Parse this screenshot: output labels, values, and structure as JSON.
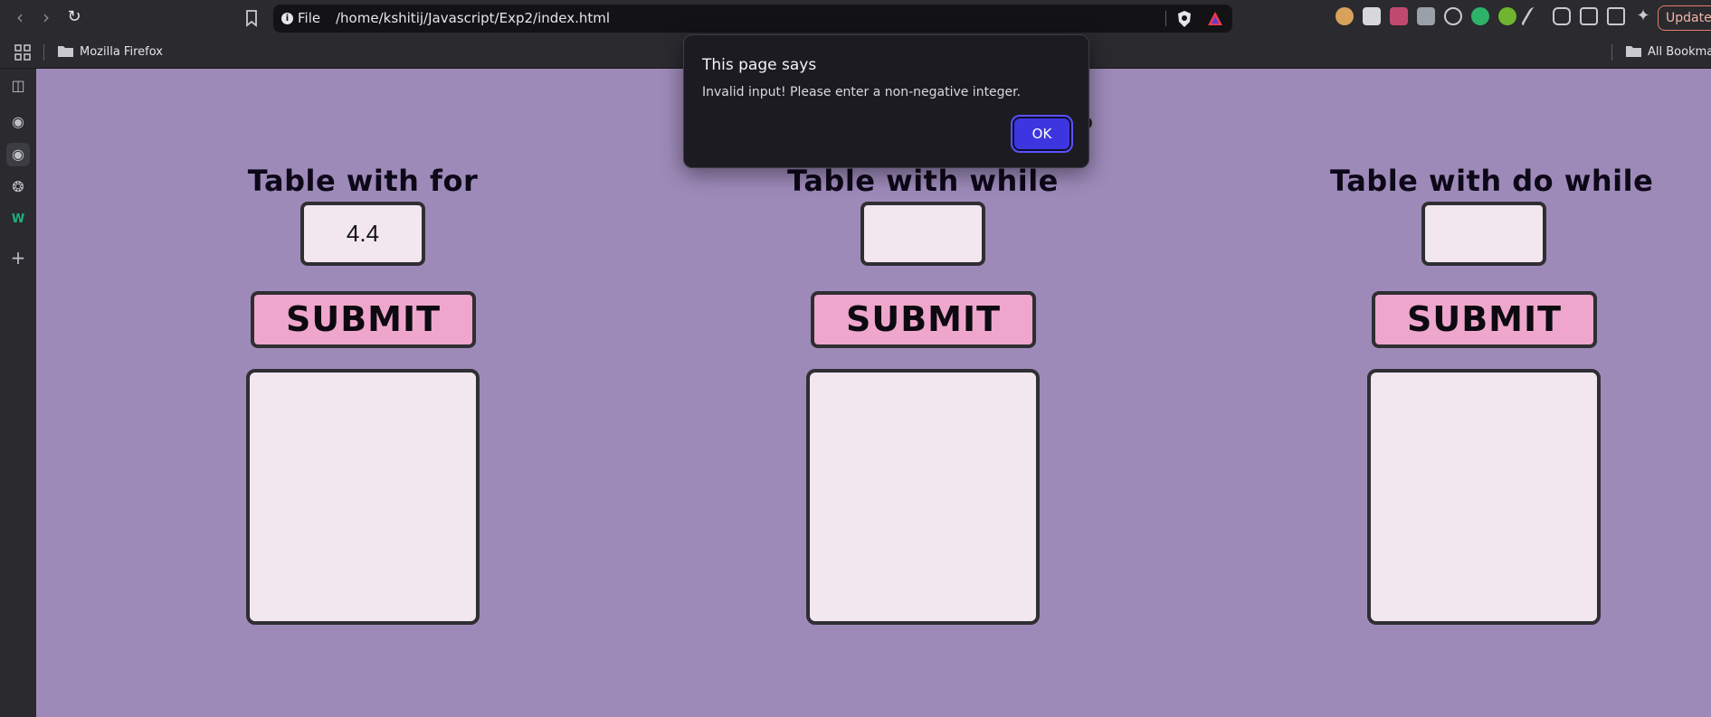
{
  "browser": {
    "url_scheme": "File",
    "url": "/home/kshitij/Javascript/Exp2/index.html",
    "update_label": "Update",
    "bookmarks": [
      {
        "label": "Mozilla Firefox"
      },
      {
        "label": "All Bookmarks"
      }
    ],
    "extensions": [
      "fox-icon",
      "check-icon",
      "brush-icon",
      "bookmark-k-icon",
      "react-icon",
      "cursor-icon",
      "plus-circle-icon",
      "eyedropper-icon",
      "puzzle-icon",
      "sidebar-icon",
      "wallet-icon",
      "sparkle-icon"
    ],
    "sidebar_icons": [
      "sidebar-panel-icon",
      "globe-icon",
      "globe-icon",
      "openai-icon",
      "w-icon",
      "plus-icon"
    ]
  },
  "page": {
    "background": "#9d8ab9",
    "sections": [
      {
        "title": "Table with for",
        "input_value": "4.4",
        "submit_label": "SUBMIT"
      },
      {
        "title": "Table with while",
        "input_value": "",
        "submit_label": "SUBMIT"
      },
      {
        "title": "Table with do while",
        "input_value": "",
        "submit_label": "SUBMIT"
      }
    ]
  },
  "dialog": {
    "title": "This page says",
    "message": "Invalid input! Please enter a non-negative integer.",
    "ok_label": "OK"
  },
  "colors": {
    "accent_button": "#3d36e0",
    "submit_bg": "#efa6cc",
    "field_bg": "#f2e6ef"
  }
}
